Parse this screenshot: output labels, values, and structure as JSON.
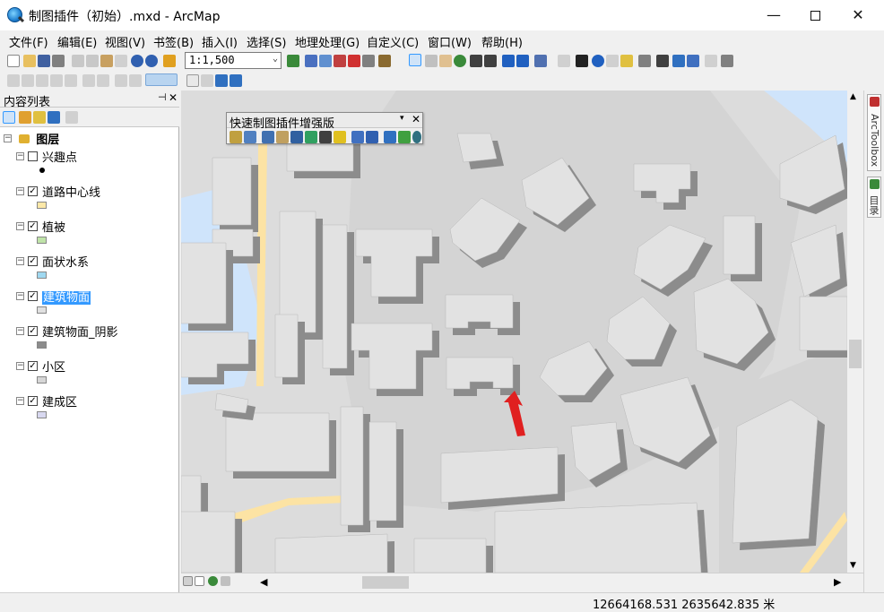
{
  "window": {
    "title": "制图插件（初始）.mxd - ArcMap",
    "min_glyph": "—",
    "close_glyph": "✕"
  },
  "menu": [
    "文件(F)",
    "编辑(E)",
    "视图(V)",
    "书签(B)",
    "插入(I)",
    "选择(S)",
    "地理处理(G)",
    "自定义(C)",
    "窗口(W)",
    "帮助(H)"
  ],
  "toolbar": {
    "scale": "1:1,500",
    "scale_arrow": "⌄"
  },
  "toc": {
    "title": "内容列表",
    "pin_glyph": "⊣",
    "close_glyph": "✕",
    "root_label": "图层",
    "layers": [
      {
        "label": "兴趣点",
        "checked": false,
        "symbol": "point",
        "color": "#000000"
      },
      {
        "label": "道路中心线",
        "checked": true,
        "symbol": "fill",
        "color": "#fce8a8"
      },
      {
        "label": "植被",
        "checked": true,
        "symbol": "fill",
        "color": "#bfe3a8"
      },
      {
        "label": "面状水系",
        "checked": true,
        "symbol": "fill",
        "color": "#9fd8f0"
      },
      {
        "label": "建筑物面",
        "checked": true,
        "symbol": "fill",
        "color": "#e0e0e0",
        "selected": true
      },
      {
        "label": "建筑物面_阴影",
        "checked": true,
        "symbol": "fill",
        "color": "#8c8c8c"
      },
      {
        "label": "小区",
        "checked": true,
        "symbol": "fill",
        "color": "#d6d6d6"
      },
      {
        "label": "建成区",
        "checked": true,
        "symbol": "fill",
        "color": "#d8d8f0"
      }
    ],
    "collapse_glyph": "−",
    "check_glyph": "✓"
  },
  "floating_toolbar": {
    "title": "快速制图插件增强版",
    "drop_glyph": "▾",
    "close_glyph": "✕"
  },
  "right_dock": {
    "tabs": [
      "ArcToolbox",
      "目录"
    ]
  },
  "status": {
    "coordinates": "12664168.531  2635642.835 米"
  },
  "colors": {
    "water": "#cfe4fb",
    "community": "#d4d4d4",
    "built_up": "#dcdcdc",
    "building": "#e2e2e2",
    "building_shadow": "#8c8c8c",
    "road": "#fce3a4",
    "arrow": "#e02020"
  }
}
